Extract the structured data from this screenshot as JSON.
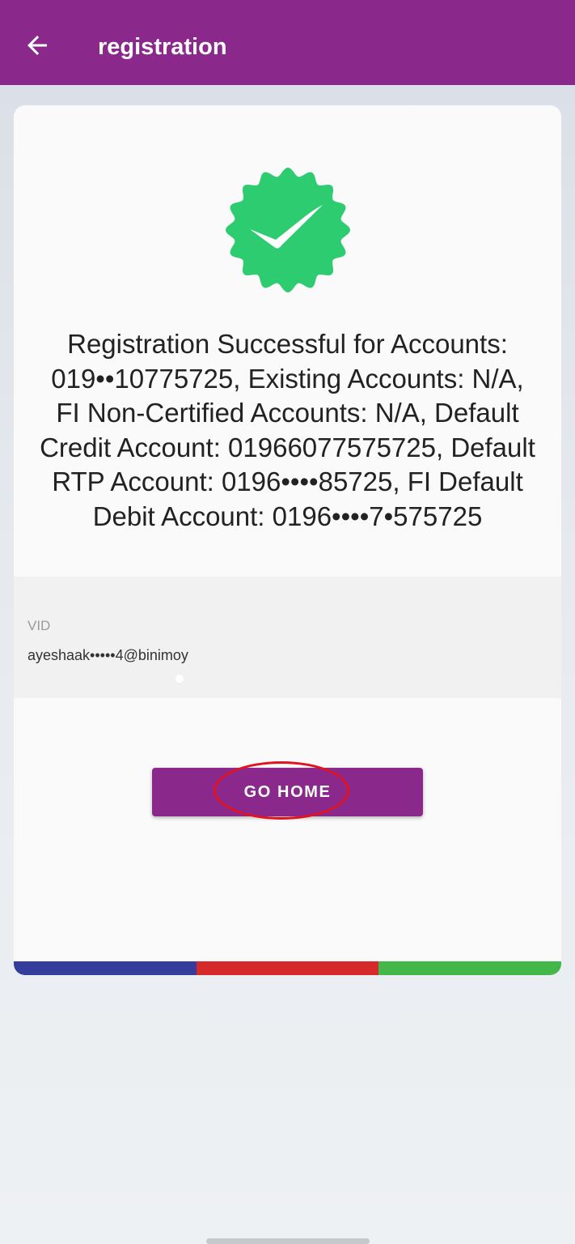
{
  "app_bar": {
    "title": "registration",
    "back_icon": "arrow-back-icon",
    "background_color": "#8a288c"
  },
  "card": {
    "badge_icon": "verified-check-badge-icon",
    "badge_color": "#2ecc71",
    "message": "Registration Successful for Accounts:\n019••10775725, Existing Accounts: N/A,\nFI Non-Certified Accounts: N/A, Default\nCredit Account: 01966077575725, Default\nRTP Account: 0196••••85725,  FI Default\nDebit Account: 0196••••7•575725",
    "vid": {
      "label": "VID",
      "value": "ayeshaak•••••4@binimoy"
    },
    "go_home_label": "GO HOME",
    "footer_colors": [
      "#343d9c",
      "#d42a2a",
      "#44b74a"
    ]
  }
}
